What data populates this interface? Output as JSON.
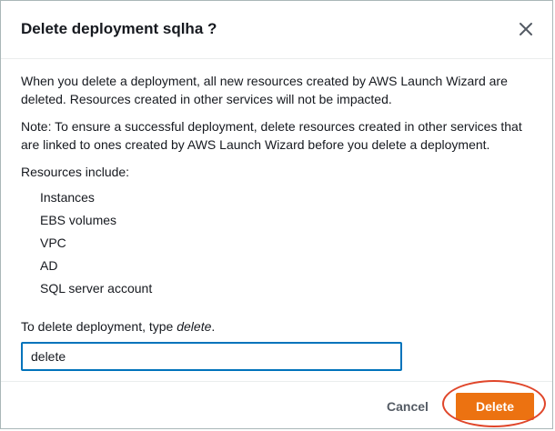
{
  "dialog": {
    "title": "Delete deployment sqlha ?",
    "paragraph_1": "When you delete a deployment, all new resources created by AWS Launch Wizard are deleted. Resources created in other services will not be impacted.",
    "paragraph_2": "Note: To ensure a successful deployment, delete resources created in other services that are linked to ones created by AWS Launch Wizard before you delete a deployment.",
    "resources_label": "Resources include:",
    "resources": [
      "Instances",
      "EBS volumes",
      "VPC",
      "AD",
      "SQL server account"
    ],
    "confirm_prefix": "To delete deployment, type ",
    "confirm_keyword": "delete",
    "confirm_suffix": ".",
    "input_value": "delete"
  },
  "footer": {
    "cancel_label": "Cancel",
    "delete_label": "Delete"
  },
  "icons": {
    "close": "close-icon"
  },
  "colors": {
    "primary_button": "#ec7211",
    "input_focus_border": "#0073bb",
    "highlight_ring": "#e0462a"
  }
}
